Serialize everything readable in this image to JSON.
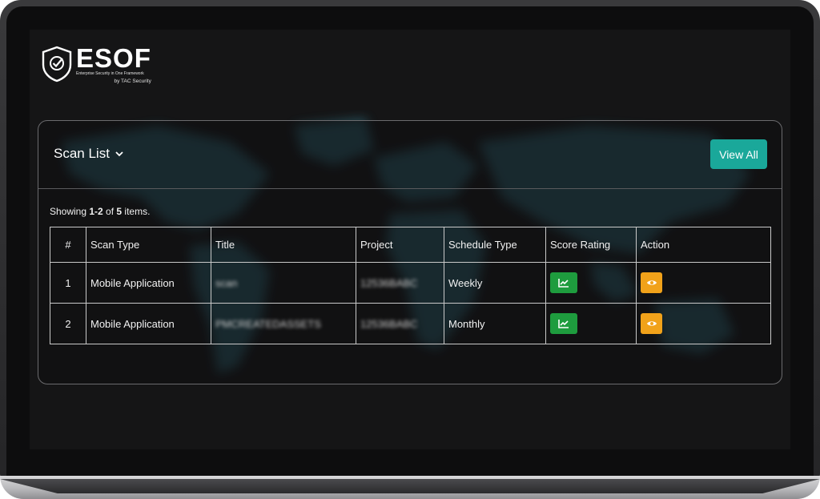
{
  "brand": {
    "name": "ESOF",
    "tagline": "Enterprise Security in One Framework",
    "by": "by TAC Security"
  },
  "panel": {
    "title": "Scan List",
    "view_all_label": "View All",
    "summary_prefix": "Showing ",
    "summary_range": "1-2",
    "summary_of": " of ",
    "summary_total": "5",
    "summary_suffix": " items."
  },
  "table": {
    "headers": [
      "#",
      "Scan Type",
      "Title",
      "Project",
      "Schedule Type",
      "Score Rating",
      "Action"
    ],
    "rows": [
      {
        "num": "1",
        "scan_type": "Mobile Application",
        "title": "scan",
        "project": "12536BABC",
        "schedule": "Weekly"
      },
      {
        "num": "2",
        "scan_type": "Mobile Application",
        "title": "PMCREATEDASSETS",
        "project": "12536BABC",
        "schedule": "Monthly"
      }
    ]
  },
  "colors": {
    "accent": "#1aa89a",
    "score_button": "#1e9c3e",
    "action_button": "#f1a21a",
    "map": "#2c5a66"
  },
  "icons": {
    "logo": "shield-check-icon",
    "dropdown": "chevron-down-icon",
    "score": "line-chart-icon",
    "action": "eye-icon"
  }
}
